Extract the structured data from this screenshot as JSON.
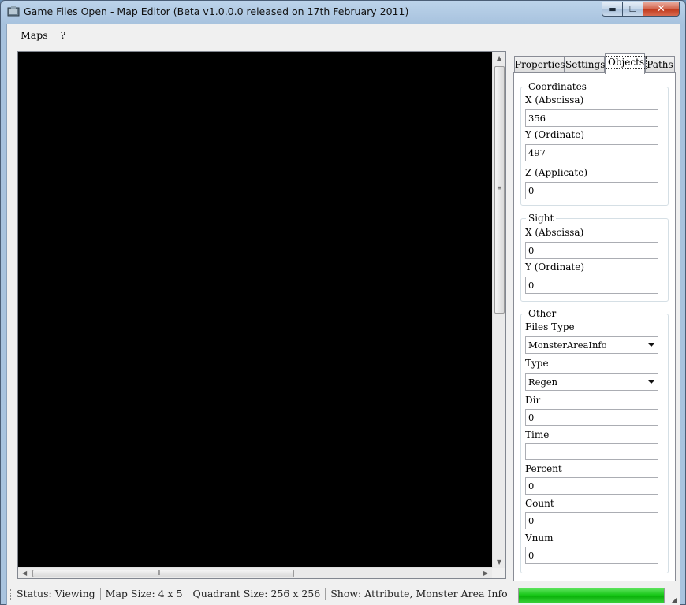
{
  "window": {
    "title": "Game Files Open - Map Editor (Beta v1.0.0.0 released on 17th February 2011)",
    "caption_buttons": {
      "minimize": "▬",
      "maximize": "☐",
      "close": "✕"
    }
  },
  "menu": [
    "Maps",
    "?"
  ],
  "tabs": [
    {
      "label": "Properties",
      "active": false
    },
    {
      "label": "Settings",
      "active": false
    },
    {
      "label": "Objects",
      "active": true
    },
    {
      "label": "Paths",
      "active": false
    }
  ],
  "coordinates": {
    "title": "Coordinates",
    "x_label": "X (Abscissa)",
    "x_value": "356",
    "y_label": "Y (Ordinate)",
    "y_value": "497",
    "z_label": "Z (Applicate)",
    "z_value": "0"
  },
  "sight": {
    "title": "Sight",
    "x_label": "X (Abscissa)",
    "x_value": "0",
    "y_label": "Y (Ordinate)",
    "y_value": "0"
  },
  "other": {
    "title": "Other",
    "files_type_label": "Files Type",
    "files_type_value": "MonsterAreaInfo",
    "type_label": "Type",
    "type_value": "Regen",
    "dir_label": "Dir",
    "dir_value": "0",
    "time_label": "Time",
    "time_value": "",
    "percent_label": "Percent",
    "percent_value": "0",
    "count_label": "Count",
    "count_value": "0",
    "vnum_label": "Vnum",
    "vnum_value": "0"
  },
  "status": {
    "status": "Status: Viewing",
    "map_size": "Map Size: 4 x 5",
    "quadrant_size": "Quadrant Size: 256 x 256",
    "show": "Show: Attribute, Monster Area Info",
    "progress": 1.0
  },
  "icons": {
    "scroll_up": "▲",
    "scroll_down": "▼",
    "scroll_left": "◀",
    "scroll_right": "▶",
    "v_grip": "≡",
    "h_grip": "⦀",
    "size_grip": "◢"
  },
  "colors": {
    "map_background": "#000000",
    "progress": "#13c413",
    "window_frame": "#a9c4df"
  }
}
